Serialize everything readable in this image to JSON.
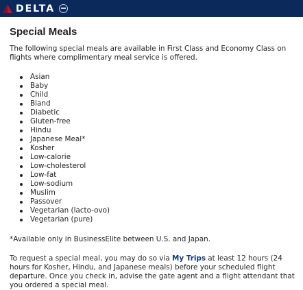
{
  "header": {
    "brand": "DELTA"
  },
  "page": {
    "title": "Special Meals",
    "intro": "The following special meals are available in First Class and Economy Class on flights where complimentary meal service is offered.",
    "meals": [
      "Asian",
      "Baby",
      "Child",
      "Bland",
      "Diabetic",
      "Gluten-free",
      "Hindu",
      "Japanese Meal*",
      "Kosher",
      "Low-calorie",
      "Low-cholesterol",
      "Low-fat",
      "Low-sodium",
      "Muslim",
      "Passover",
      "Vegetarian (lacto-ovo)",
      "Vegetarian (pure)"
    ],
    "footnote": "*Available only in BusinessElite between U.S. and Japan.",
    "request_before": "To request a special meal, you may do so via ",
    "request_link": "My Trips",
    "request_after": " at least 12 hours (24 hours for Kosher, Hindu, and Japanese meals) before your scheduled flight departure. Once you check in, advise the gate agent and a flight attendant that you ordered a special meal."
  },
  "colors": {
    "header_bg": "#0b2a5b",
    "logo_red": "#c8102e",
    "link": "#123a7a"
  }
}
